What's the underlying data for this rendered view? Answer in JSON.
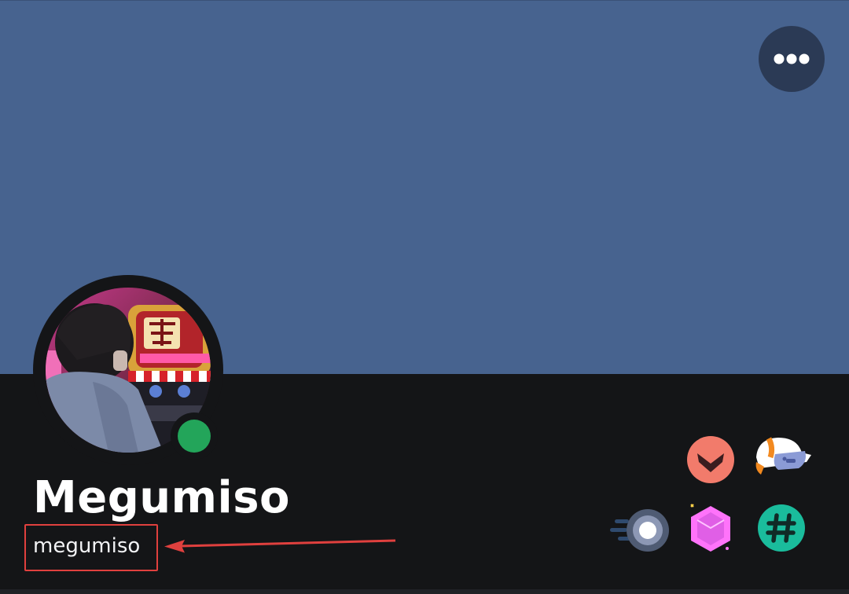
{
  "profile": {
    "display_name": "Megumiso",
    "username": "megumiso",
    "status": "online"
  },
  "header": {
    "more_button_icon": "more-horizontal-icon"
  },
  "badges": [
    {
      "icon": "hypesquad-brilliance-icon",
      "color": "#f27b6b"
    },
    {
      "icon": "quest-badge-icon",
      "color": "#5865f2"
    },
    {
      "icon": "nitro-speed-icon",
      "color": "#4e5d94"
    },
    {
      "icon": "server-booster-icon",
      "color": "#ff73fa"
    },
    {
      "icon": "active-developer-icon",
      "color": "#1abc9c"
    }
  ],
  "colors": {
    "banner": "#47638f",
    "panel": "#141517",
    "status_online": "#23a55a",
    "annotation": "#e0403e"
  }
}
